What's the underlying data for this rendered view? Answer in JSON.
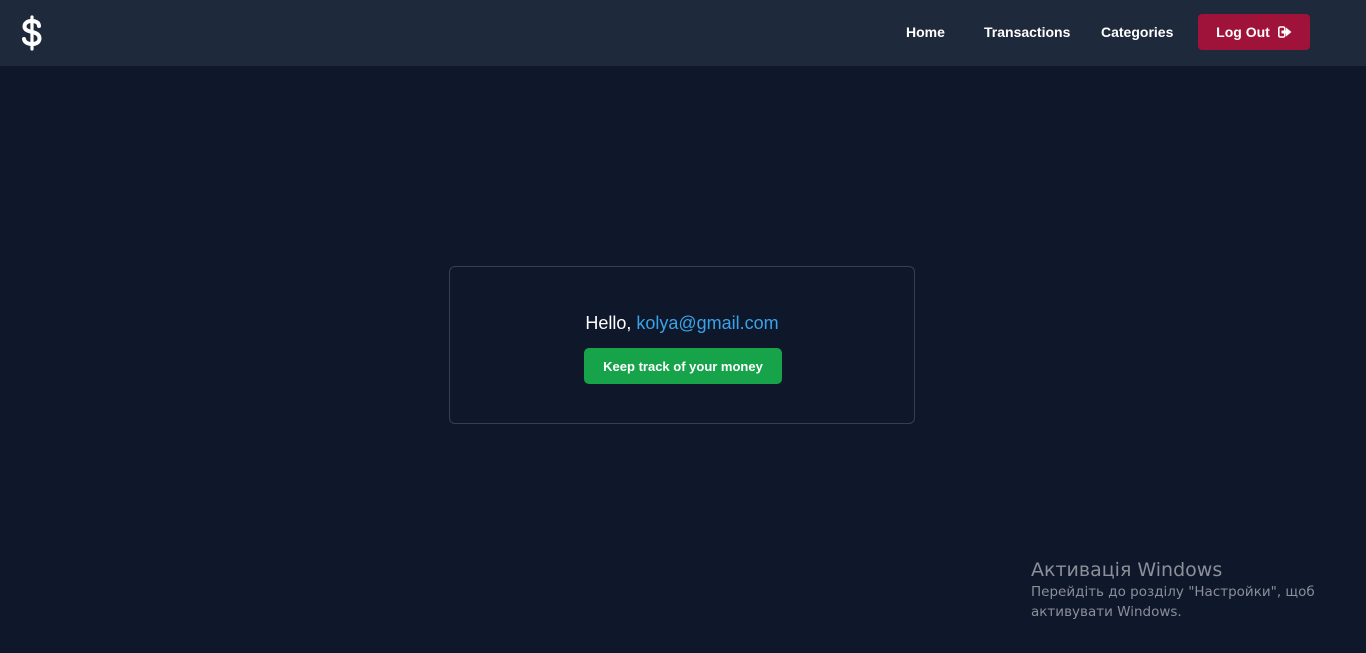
{
  "header": {
    "logo_icon": "dollar-sign-icon",
    "nav": {
      "home": "Home",
      "transactions": "Transactions",
      "categories": "Categories"
    },
    "logout": {
      "label": "Log Out",
      "icon": "sign-out-icon",
      "color": "#9f1239"
    }
  },
  "main": {
    "greeting_prefix": "Hello, ",
    "user_email": "kolya@gmail.com",
    "cta_label": "Keep track of your money",
    "cta_color": "#16a34a"
  },
  "windows_activation": {
    "title": "Активація Windows",
    "line1": "Перейдіть до розділу \"Настройки\", щоб",
    "line2": "активувати Windows."
  },
  "colors": {
    "background": "#0f172a",
    "header_background": "#1e293b",
    "email_link": "#38a3e8"
  }
}
